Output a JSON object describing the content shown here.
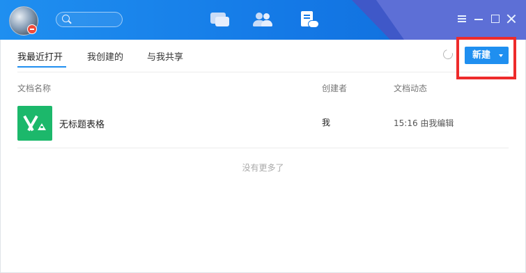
{
  "tabs": [
    {
      "label": "我最近打开",
      "active": true
    },
    {
      "label": "我创建的",
      "active": false
    },
    {
      "label": "与我共享",
      "active": false
    }
  ],
  "toolbar": {
    "new_label": "新建"
  },
  "columns": {
    "name": "文档名称",
    "creator": "创建者",
    "activity": "文档动态"
  },
  "files": [
    {
      "icon": "spreadsheet-icon",
      "name": "无标题表格",
      "creator": "我",
      "activity": "15:16 由我编辑"
    }
  ],
  "empty_hint": "没有更多了",
  "colors": {
    "accent": "#1f8ff0",
    "file_icon_bg": "#1cb86b",
    "highlight": "#ee2b2b",
    "badge": "#f04a3a"
  }
}
